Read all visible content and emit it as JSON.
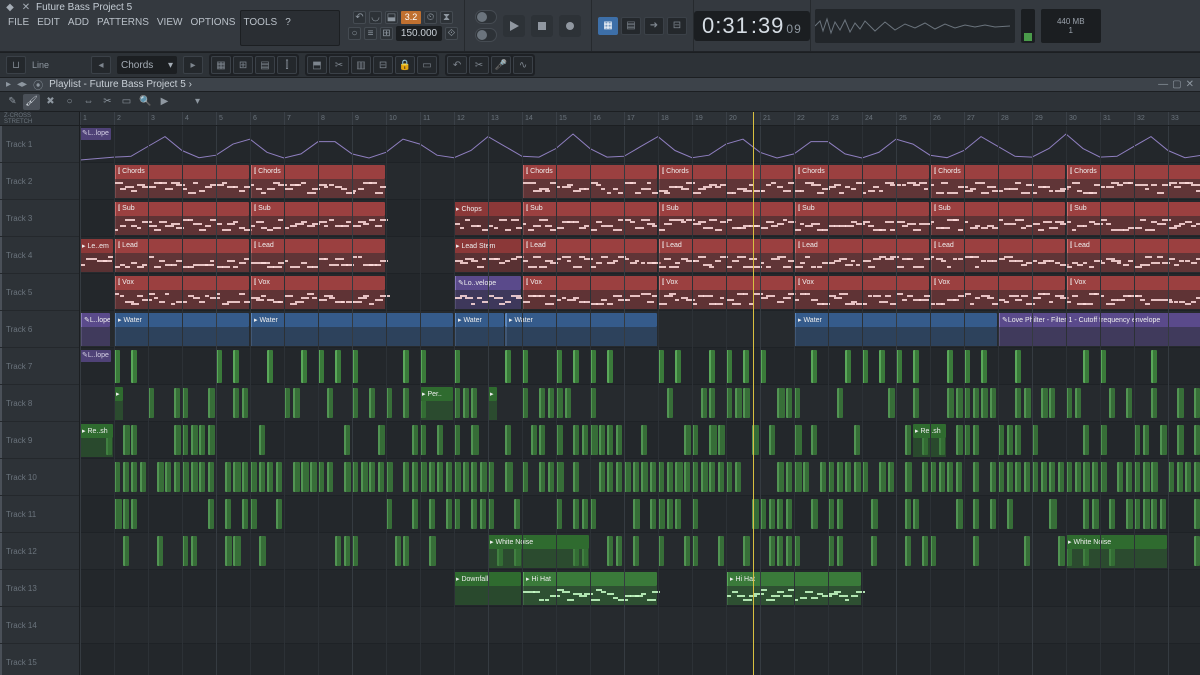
{
  "app": {
    "project_title": "Future Bass Project 5",
    "playlist_title": "Playlist - Future Bass Project 5 ›",
    "tempo": "150.000",
    "pattern_num": "3.2",
    "time_display": {
      "min": "0:31",
      "sec": ":39",
      "sub": " 09"
    },
    "memory": "440 MB",
    "memory_sub": "1",
    "snap_mode": "Line",
    "chord_helper": "Chords"
  },
  "menu": [
    "FILE",
    "EDIT",
    "ADD",
    "PATTERNS",
    "VIEW",
    "OPTIONS",
    "TOOLS",
    "?"
  ],
  "ruler_start": 1,
  "ruler_bars": 34,
  "playhead_bar": 20.8,
  "tracks": [
    {
      "n": 1,
      "label": "Track 1"
    },
    {
      "n": 2,
      "label": "Track 2"
    },
    {
      "n": 3,
      "label": "Track 3"
    },
    {
      "n": 4,
      "label": "Track 4"
    },
    {
      "n": 5,
      "label": "Track 5"
    },
    {
      "n": 6,
      "label": "Track 6"
    },
    {
      "n": 7,
      "label": "Track 7"
    },
    {
      "n": 8,
      "label": "Track 8"
    },
    {
      "n": 9,
      "label": "Track 9"
    },
    {
      "n": 10,
      "label": "Track 10"
    },
    {
      "n": 11,
      "label": "Track 11"
    },
    {
      "n": 12,
      "label": "Track 12"
    },
    {
      "n": 13,
      "label": "Track 13"
    },
    {
      "n": 14,
      "label": "Track 14"
    },
    {
      "n": 15,
      "label": "Track 15"
    }
  ],
  "clips": {
    "track1_env": [
      {
        "label": "✎L..lope",
        "bar": 1,
        "len": 0.9,
        "cls": "c-purple"
      }
    ],
    "track2": [
      {
        "label": "⫿ Chords",
        "bar": 2,
        "len": 4,
        "cls": "c-red"
      },
      {
        "label": "⫿ Chords",
        "bar": 6,
        "len": 4,
        "cls": "c-red"
      },
      {
        "label": "⫿ Chords",
        "bar": 14,
        "len": 4,
        "cls": "c-red"
      },
      {
        "label": "⫿ Chords",
        "bar": 18,
        "len": 4,
        "cls": "c-red"
      },
      {
        "label": "⫿ Chords",
        "bar": 22,
        "len": 4,
        "cls": "c-red"
      },
      {
        "label": "⫿ Chords",
        "bar": 26,
        "len": 4,
        "cls": "c-red"
      },
      {
        "label": "⫿ Chords",
        "bar": 30,
        "len": 4,
        "cls": "c-red"
      }
    ],
    "track3": [
      {
        "label": "⫿ Sub",
        "bar": 2,
        "len": 4,
        "cls": "c-red"
      },
      {
        "label": "⫿ Sub",
        "bar": 6,
        "len": 4,
        "cls": "c-red"
      },
      {
        "label": "▸ Chops",
        "bar": 12,
        "len": 2,
        "cls": "c-red2"
      },
      {
        "label": "⫿ Sub",
        "bar": 14,
        "len": 4,
        "cls": "c-red"
      },
      {
        "label": "⫿ Sub",
        "bar": 18,
        "len": 4,
        "cls": "c-red"
      },
      {
        "label": "⫿ Sub",
        "bar": 22,
        "len": 4,
        "cls": "c-red"
      },
      {
        "label": "⫿ Sub",
        "bar": 26,
        "len": 4,
        "cls": "c-red"
      },
      {
        "label": "⫿ Sub",
        "bar": 30,
        "len": 4,
        "cls": "c-red"
      }
    ],
    "track4": [
      {
        "label": "▸ Le..em",
        "bar": 1,
        "len": 1,
        "cls": "c-red2"
      },
      {
        "label": "⫿ Lead",
        "bar": 2,
        "len": 4,
        "cls": "c-red"
      },
      {
        "label": "⫿ Lead",
        "bar": 6,
        "len": 4,
        "cls": "c-red"
      },
      {
        "label": "▸ Lead Stem",
        "bar": 12,
        "len": 2,
        "cls": "c-red2"
      },
      {
        "label": "⫿ Lead",
        "bar": 14,
        "len": 4,
        "cls": "c-red"
      },
      {
        "label": "⫿ Lead",
        "bar": 18,
        "len": 4,
        "cls": "c-red"
      },
      {
        "label": "⫿ Lead",
        "bar": 22,
        "len": 4,
        "cls": "c-red"
      },
      {
        "label": "⫿ Lead",
        "bar": 26,
        "len": 4,
        "cls": "c-red"
      },
      {
        "label": "⫿ Lead",
        "bar": 30,
        "len": 4,
        "cls": "c-red"
      }
    ],
    "track5": [
      {
        "label": "⫿ Vox",
        "bar": 2,
        "len": 4,
        "cls": "c-red"
      },
      {
        "label": "⫿ Vox",
        "bar": 6,
        "len": 4,
        "cls": "c-red"
      },
      {
        "label": "✎Lo..velope",
        "bar": 12,
        "len": 2,
        "cls": "c-purple"
      },
      {
        "label": "⫿ Vox",
        "bar": 14,
        "len": 4,
        "cls": "c-red"
      },
      {
        "label": "⫿ Vox",
        "bar": 18,
        "len": 4,
        "cls": "c-red"
      },
      {
        "label": "⫿ Vox",
        "bar": 22,
        "len": 4,
        "cls": "c-red"
      },
      {
        "label": "⫿ Vox",
        "bar": 26,
        "len": 4,
        "cls": "c-red"
      },
      {
        "label": "⫿ Vox",
        "bar": 30,
        "len": 4,
        "cls": "c-red"
      }
    ],
    "track6": [
      {
        "label": "✎L..lope",
        "bar": 1,
        "len": 0.9,
        "cls": "c-purple"
      },
      {
        "label": "▸ Water",
        "bar": 2,
        "len": 4,
        "cls": "c-blue"
      },
      {
        "label": "▸ Water",
        "bar": 6,
        "len": 6,
        "cls": "c-blue"
      },
      {
        "label": "▸ Water",
        "bar": 12,
        "len": 1.5,
        "cls": "c-blue"
      },
      {
        "label": "▸ Water",
        "bar": 13.5,
        "len": 4.5,
        "cls": "c-blue"
      },
      {
        "label": "▸ Water",
        "bar": 22,
        "len": 6,
        "cls": "c-blue"
      },
      {
        "label": "✎Love Philter - Filter 1 - Cutoff frequency envelope",
        "bar": 28,
        "len": 6,
        "cls": "c-purple"
      }
    ],
    "track7_env": {
      "label": "✎L..lope",
      "bar": 1,
      "len": 0.9
    },
    "track8_perc": [
      {
        "label": "▸",
        "bar": 2,
        "len": 0.3
      },
      {
        "label": "▸ Per..",
        "bar": 11,
        "len": 1
      },
      {
        "label": "▸",
        "bar": 13,
        "len": 0.3
      }
    ],
    "track9": [
      {
        "label": "▸ Re..sh",
        "bar": 1,
        "len": 1,
        "cls": "c-green2"
      },
      {
        "label": "▸ Re..sh",
        "bar": 25.5,
        "len": 1,
        "cls": "c-green2"
      }
    ],
    "track12": [
      {
        "label": "▸ White Noise",
        "bar": 13,
        "len": 3,
        "cls": "c-green2"
      },
      {
        "label": "▸ White Noise",
        "bar": 30,
        "len": 3,
        "cls": "c-green2"
      }
    ],
    "track13": [
      {
        "label": "▸ Downfall",
        "bar": 12,
        "len": 2,
        "cls": "c-green2"
      },
      {
        "label": "▸ Hi Hat",
        "bar": 14,
        "len": 4,
        "cls": "c-green"
      },
      {
        "label": "▸ Hi Hat",
        "bar": 20,
        "len": 4,
        "cls": "c-green"
      }
    ]
  },
  "z_labels": {
    "zcross": "Z-CROSS",
    "stretch": "STRETCH"
  }
}
